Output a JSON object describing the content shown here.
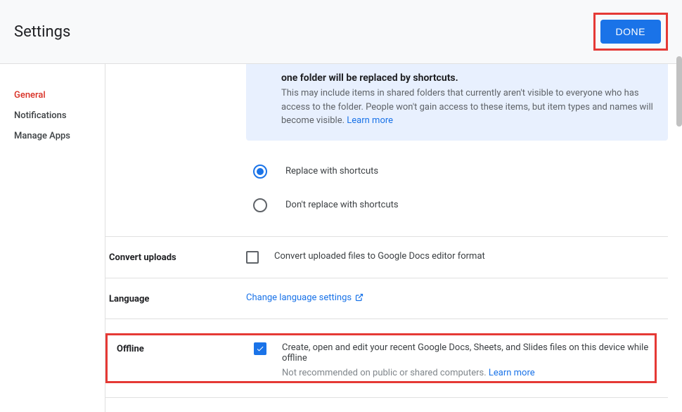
{
  "header": {
    "title": "Settings",
    "done": "DONE"
  },
  "sidebar": {
    "items": [
      {
        "label": "General",
        "active": true
      },
      {
        "label": "Notifications",
        "active": false
      },
      {
        "label": "Manage Apps",
        "active": false
      }
    ]
  },
  "info": {
    "title": "one folder will be replaced by shortcuts.",
    "text": "This may include items in shared folders that currently aren't visible to everyone who has access to the folder. People won't gain access to these items, but item types and names will become visible. ",
    "learn": "Learn more"
  },
  "replace": {
    "opt1": "Replace with shortcuts",
    "opt2": "Don't replace with shortcuts"
  },
  "convert": {
    "label": "Convert uploads",
    "text": "Convert uploaded files to Google Docs editor format"
  },
  "language": {
    "label": "Language",
    "link": "Change language settings"
  },
  "offline": {
    "label": "Offline",
    "text": "Create, open and edit your recent Google Docs, Sheets, and Slides files on this device while offline",
    "sub": "Not recommended on public or shared computers. ",
    "learn": "Learn more"
  }
}
